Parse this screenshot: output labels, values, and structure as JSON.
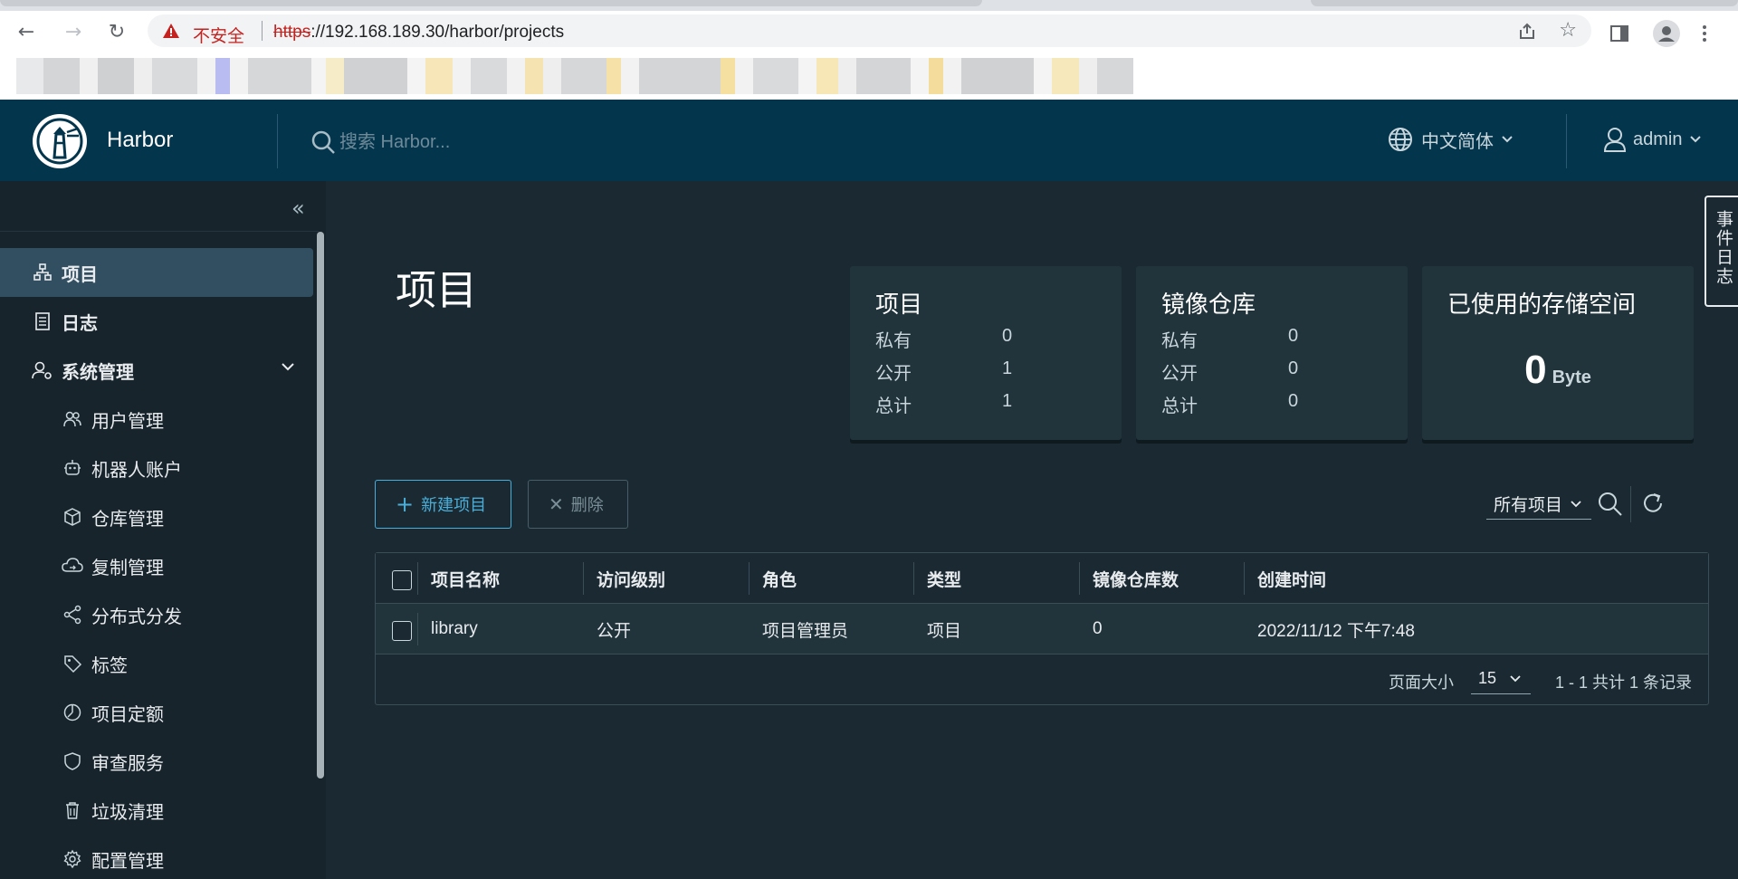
{
  "browser": {
    "insecure_label": "不安全",
    "url_proto": "https",
    "url_rest": "://192.168.189.30/harbor/projects"
  },
  "header": {
    "brand": "Harbor",
    "search_placeholder": "搜索 Harbor...",
    "language": "中文简体",
    "user": "admin"
  },
  "sidebar": {
    "items": [
      {
        "label": "项目",
        "icon": "projects-icon",
        "active": true
      },
      {
        "label": "日志",
        "icon": "logs-icon"
      },
      {
        "label": "系统管理",
        "icon": "admin-icon",
        "expanded": true
      }
    ],
    "sub_items": [
      {
        "label": "用户管理",
        "icon": "users-icon"
      },
      {
        "label": "机器人账户",
        "icon": "robot-icon"
      },
      {
        "label": "仓库管理",
        "icon": "registry-icon"
      },
      {
        "label": "复制管理",
        "icon": "replication-icon"
      },
      {
        "label": "分布式分发",
        "icon": "distribution-icon"
      },
      {
        "label": "标签",
        "icon": "tag-icon"
      },
      {
        "label": "项目定额",
        "icon": "quota-icon"
      },
      {
        "label": "审查服务",
        "icon": "scan-icon"
      },
      {
        "label": "垃圾清理",
        "icon": "trash-icon"
      },
      {
        "label": "配置管理",
        "icon": "gear-icon"
      }
    ]
  },
  "main": {
    "title": "项目",
    "cards": [
      {
        "title": "项目",
        "rows": [
          {
            "k": "私有",
            "v": "0"
          },
          {
            "k": "公开",
            "v": "1"
          },
          {
            "k": "总计",
            "v": "1"
          }
        ]
      },
      {
        "title": "镜像仓库",
        "rows": [
          {
            "k": "私有",
            "v": "0"
          },
          {
            "k": "公开",
            "v": "0"
          },
          {
            "k": "总计",
            "v": "0"
          }
        ]
      },
      {
        "title": "已使用的存储空间",
        "value": "0",
        "unit": "Byte"
      }
    ],
    "new_button": "新建项目",
    "delete_button": "删除",
    "filter": "所有项目",
    "table": {
      "columns": [
        "项目名称",
        "访问级别",
        "角色",
        "类型",
        "镜像仓库数",
        "创建时间"
      ],
      "rows": [
        {
          "name": "library",
          "access": "公开",
          "role": "项目管理员",
          "type": "项目",
          "repos": "0",
          "created": "2022/11/12 下午7:48"
        }
      ]
    },
    "footer": {
      "page_size_label": "页面大小",
      "page_size": "15",
      "record_text": "1 - 1 共计 1 条记录"
    },
    "event_tab": "事件日志"
  },
  "colors": {
    "header_bg": "#03354d",
    "sidebar_bg": "#17242b",
    "main_bg": "#1b2a32",
    "accent": "#4aaed9",
    "card_bg": "#21333b"
  }
}
